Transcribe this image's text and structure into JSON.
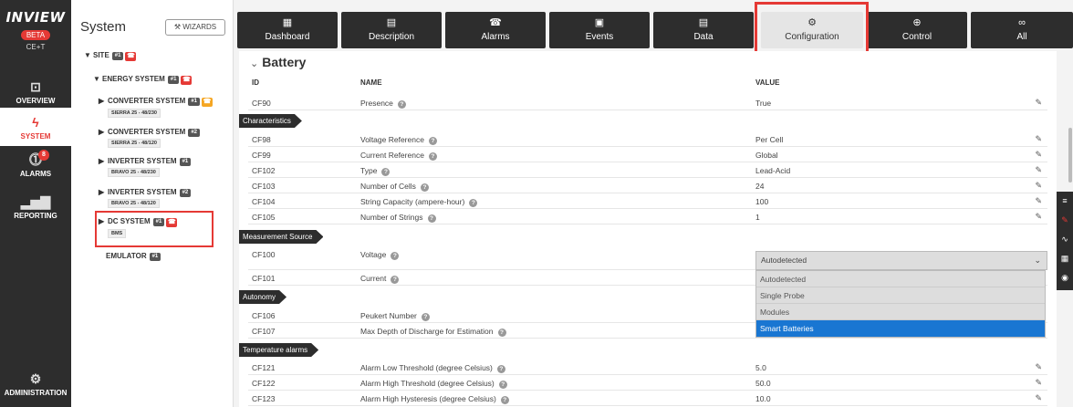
{
  "brand": {
    "logo": "INVIEW",
    "beta": "BETA",
    "sub": "CE+T"
  },
  "nav": [
    {
      "id": "overview",
      "label": "OVERVIEW",
      "icon": "monitor-icon"
    },
    {
      "id": "system",
      "label": "SYSTEM",
      "icon": "pulse-icon",
      "active": true
    },
    {
      "id": "alarms",
      "label": "ALARMS",
      "icon": "alarm-icon",
      "badge": "8"
    },
    {
      "id": "reporting",
      "label": "REPORTING",
      "icon": "bar-chart-icon"
    },
    {
      "id": "administration",
      "label": "ADMINISTRATION",
      "icon": "gear-icon"
    }
  ],
  "tree": {
    "title": "System",
    "wizards": "WIZARDS",
    "site": {
      "label": "SITE",
      "id": "#1"
    },
    "energy": {
      "label": "ENERGY SYSTEM",
      "id": "#1"
    },
    "nodes": [
      {
        "label": "CONVERTER SYSTEM",
        "id": "#1",
        "tag": "SIERRA 25 - 48/230",
        "alarm": "orange"
      },
      {
        "label": "CONVERTER SYSTEM",
        "id": "#2",
        "tag": "SIERRA 25 - 48/120"
      },
      {
        "label": "INVERTER SYSTEM",
        "id": "#1",
        "tag": "BRAVO 25 - 48/230"
      },
      {
        "label": "INVERTER SYSTEM",
        "id": "#2",
        "tag": "BRAVO 25 - 48/120"
      },
      {
        "label": "DC SYSTEM",
        "id": "#1",
        "tag": "BMS",
        "alarm": "red"
      }
    ],
    "emulator": {
      "label": "EMULATOR",
      "id": "#1"
    }
  },
  "tabs": [
    {
      "label": "Dashboard",
      "icon": "dashboard-icon"
    },
    {
      "label": "Description",
      "icon": "document-icon"
    },
    {
      "label": "Alarms",
      "icon": "alarm-icon"
    },
    {
      "label": "Events",
      "icon": "calendar-icon"
    },
    {
      "label": "Data",
      "icon": "data-icon"
    },
    {
      "label": "Configuration",
      "icon": "wrench-icon",
      "active": true
    },
    {
      "label": "Control",
      "icon": "control-icon"
    },
    {
      "label": "All",
      "icon": "infinity-icon"
    }
  ],
  "section": {
    "title": "Battery"
  },
  "headers": {
    "id": "ID",
    "name": "NAME",
    "value": "VALUE"
  },
  "groups": {
    "characteristics": "Characteristics",
    "measurement": "Measurement Source",
    "autonomy": "Autonomy",
    "temperature": "Temperature alarms"
  },
  "rows": {
    "cf90": {
      "id": "CF90",
      "name": "Presence",
      "value": "True"
    },
    "cf98": {
      "id": "CF98",
      "name": "Voltage Reference",
      "value": "Per Cell"
    },
    "cf99": {
      "id": "CF99",
      "name": "Current Reference",
      "value": "Global"
    },
    "cf102": {
      "id": "CF102",
      "name": "Type",
      "value": "Lead-Acid"
    },
    "cf103": {
      "id": "CF103",
      "name": "Number of Cells",
      "value": "24"
    },
    "cf104": {
      "id": "CF104",
      "name": "String Capacity (ampere-hour)",
      "value": "100"
    },
    "cf105": {
      "id": "CF105",
      "name": "Number of Strings",
      "value": "1"
    },
    "cf100": {
      "id": "CF100",
      "name": "Voltage",
      "value": "Autodetected"
    },
    "cf101": {
      "id": "CF101",
      "name": "Current",
      "value": ""
    },
    "cf106": {
      "id": "CF106",
      "name": "Peukert Number",
      "value": ""
    },
    "cf107": {
      "id": "CF107",
      "name": "Max Depth of Discharge for Estimation",
      "value": ""
    },
    "cf121": {
      "id": "CF121",
      "name": "Alarm Low Threshold (degree Celsius)",
      "value": "5.0"
    },
    "cf122": {
      "id": "CF122",
      "name": "Alarm High Threshold (degree Celsius)",
      "value": "50.0"
    },
    "cf123": {
      "id": "CF123",
      "name": "Alarm High Hysteresis (degree Celsius)",
      "value": "10.0"
    }
  },
  "dropdown": {
    "selected": "Autodetected",
    "options": [
      "Autodetected",
      "Single Probe",
      "Modules",
      "Smart Batteries"
    ],
    "highlighted": "Smart Batteries"
  },
  "colors": {
    "accent": "#e53935",
    "dark": "#2d2d2d",
    "highlight": "#1976d2",
    "warning": "#f5a623"
  }
}
